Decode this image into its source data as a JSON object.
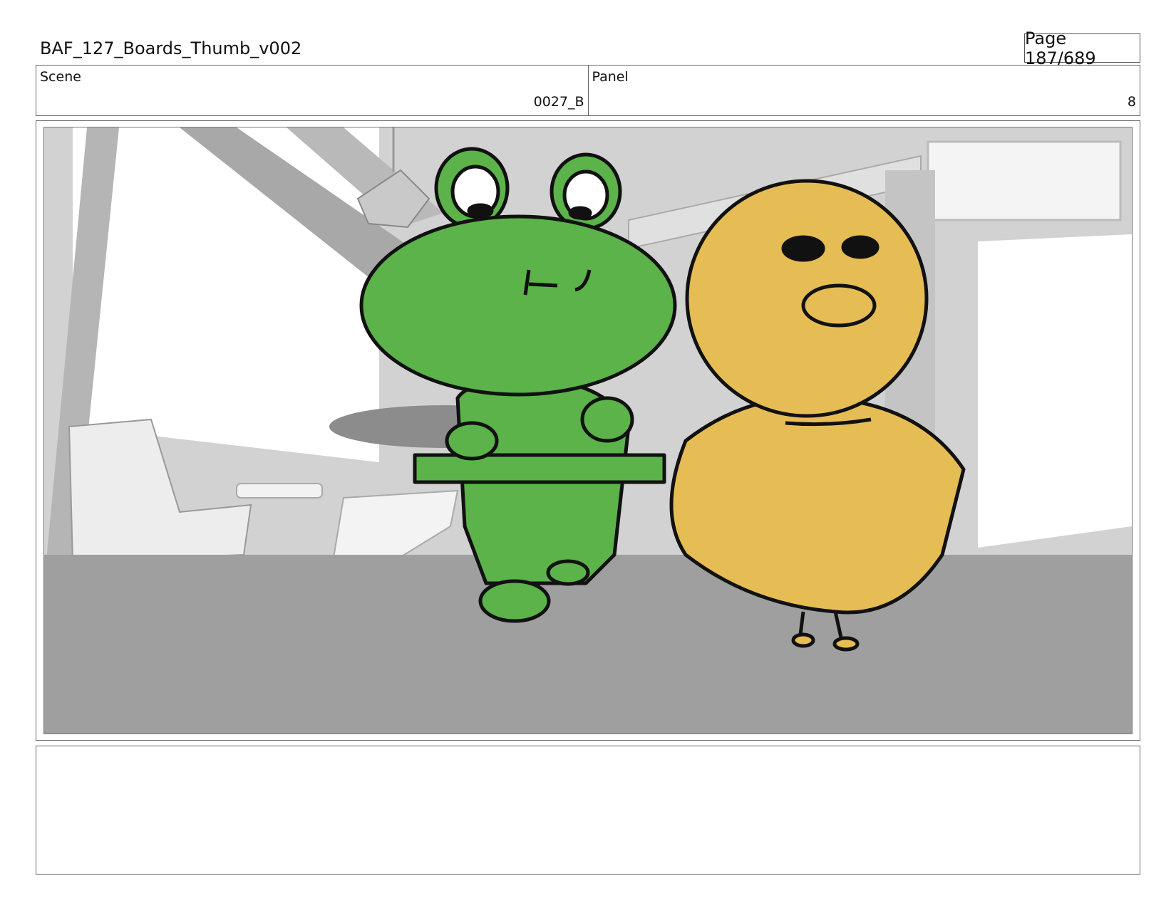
{
  "header": {
    "title": "BAF_127_Boards_Thumb_v002",
    "page": "Page 187/689"
  },
  "info": {
    "scene_label": "Scene",
    "scene_value": "0027_B",
    "panel_label": "Panel",
    "panel_value": "8"
  },
  "notes": {
    "text": ""
  },
  "colors": {
    "frog_green": "#5bb34a",
    "duck_yellow": "#e6bd55",
    "floor_gray": "#9f9f9f",
    "background_gray": "#bdbdbd"
  }
}
